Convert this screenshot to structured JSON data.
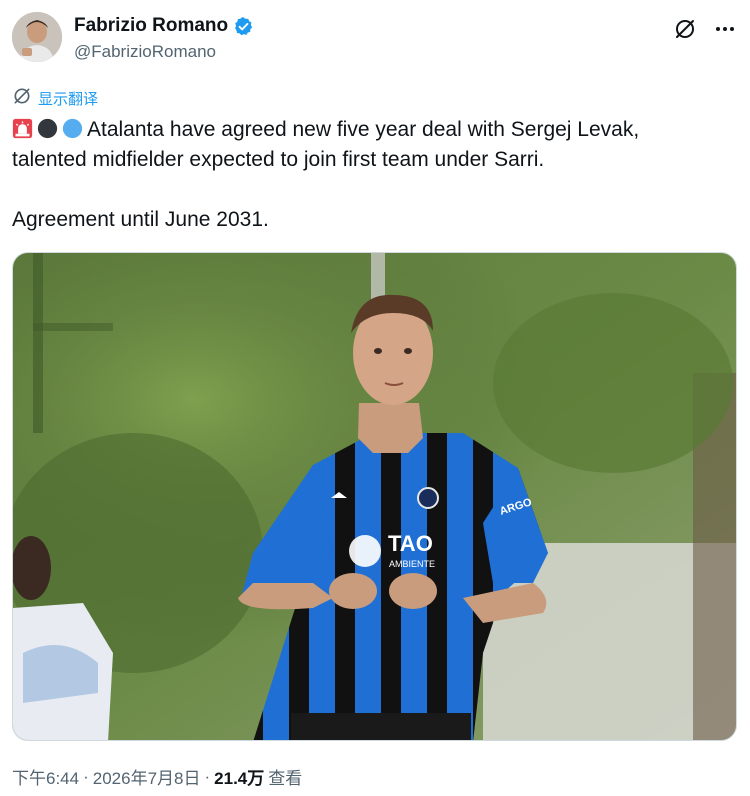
{
  "author": {
    "display_name": "Fabrizio Romano",
    "handle": "@FabrizioRomano",
    "verified": true
  },
  "translate": {
    "label": "显示翻译"
  },
  "tweet": {
    "emojis": [
      "siren-emoji",
      "black-circle-emoji",
      "blue-circle-emoji"
    ],
    "line1": "Atalanta have agreed new five year deal with Sergej Levak,",
    "line2": "talented midfielder expected to join first team under Sarri.",
    "line3": "Agreement until June 2031."
  },
  "media": {
    "shirt_sponsor": "TAO",
    "shirt_sponsor_sub": "AMBIENTE",
    "sleeve_sponsor": "ARGO"
  },
  "meta": {
    "time": "下午6:44",
    "sep1": "·",
    "date": "2026年7月8日",
    "sep2": "·",
    "views_count": "21.4万",
    "views_label": "查看"
  },
  "colors": {
    "accent": "#1d9bf0",
    "text": "#0f1419",
    "secondary": "#536471",
    "kit_blue": "#1f6fd4",
    "kit_black": "#111111"
  }
}
